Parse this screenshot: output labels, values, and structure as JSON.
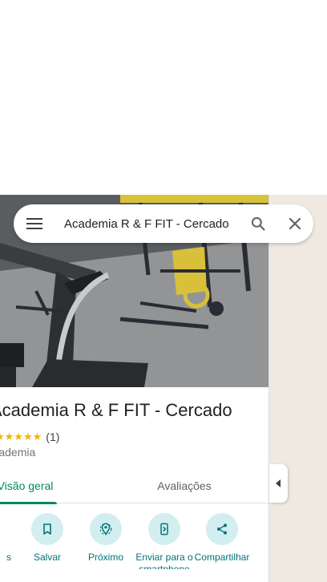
{
  "search": {
    "value": "Academia R & F FIT - Cercado"
  },
  "place": {
    "name": "Academia R & F FIT - Cercado",
    "stars": "★★★★★",
    "rating_count": "(1)",
    "category": "Academia"
  },
  "tabs": [
    {
      "label": "Visão geral",
      "selected": true
    },
    {
      "label": "Avaliações",
      "selected": false
    }
  ],
  "actions": [
    {
      "label": "Rotas",
      "icon": "directions-icon"
    },
    {
      "label": "Salvar",
      "icon": "bookmark-icon"
    },
    {
      "label": "Próximo",
      "icon": "nearby-icon"
    },
    {
      "label": "Enviar para o smartphone",
      "icon": "send-to-phone-icon"
    },
    {
      "label": "Compartilhar",
      "icon": "share-icon"
    }
  ],
  "colors": {
    "accent": "#00737a",
    "tab_accent": "#01875f",
    "star": "#f4b400",
    "action_bg": "#d2eef0"
  }
}
